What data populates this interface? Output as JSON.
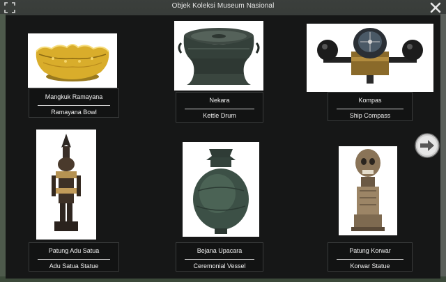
{
  "window": {
    "title": "Objek Koleksi Museum Nasional"
  },
  "icons": {
    "expand": "expand-icon",
    "close": "close-icon",
    "next": "arrow-right-icon"
  },
  "items": [
    {
      "name_id": "Mangkuk Ramayana",
      "name_en": "Ramayana Bowl",
      "image": "golden-bowl"
    },
    {
      "name_id": "Nekara",
      "name_en": "Kettle Drum",
      "image": "bronze-drum"
    },
    {
      "name_id": "Kompas",
      "name_en": "Ship Compass",
      "image": "ship-compass"
    },
    {
      "name_id": "Patung Adu Satua",
      "name_en": "Adu Satua Statue",
      "image": "wooden-statue"
    },
    {
      "name_id": "Bejana Upacara",
      "name_en": "Ceremonial Vessel",
      "image": "bronze-vessel"
    },
    {
      "name_id": "Patung Korwar",
      "name_en": "Korwar Statue",
      "image": "korwar-statue"
    }
  ],
  "colors": {
    "panel": "#161717",
    "caption_bg": "#121313",
    "text": "#f0f0f0"
  }
}
